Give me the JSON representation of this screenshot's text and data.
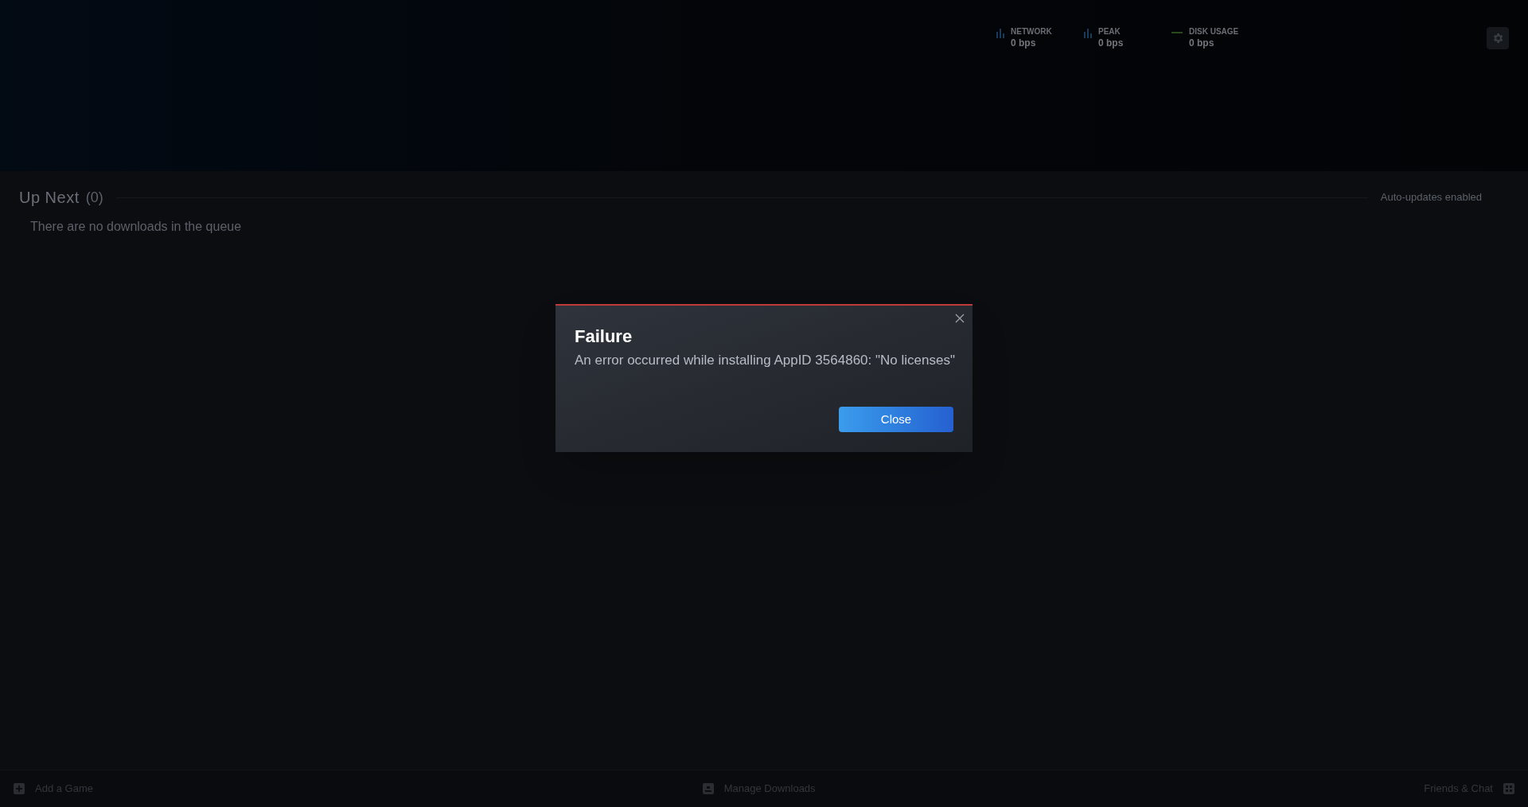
{
  "header": {
    "stats": [
      {
        "label": "NETWORK",
        "value": "0 bps",
        "kind": "bars",
        "color": "#1a3a5c"
      },
      {
        "label": "PEAK",
        "value": "0 bps",
        "kind": "bars",
        "color": "#1a3a5c"
      },
      {
        "label": "DISK USAGE",
        "value": "0 bps",
        "kind": "line",
        "color": "#2b4a1c"
      }
    ]
  },
  "queue": {
    "title": "Up Next",
    "count": "(0)",
    "auto_updates": "Auto-updates enabled",
    "empty_message": "There are no downloads in the queue"
  },
  "dialog": {
    "title": "Failure",
    "message": "An error occurred while installing AppID 3564860: \"No licenses\"",
    "button": "Close"
  },
  "footer": {
    "add_game": "Add a Game",
    "manage_downloads": "Manage Downloads",
    "friends_chat": "Friends & Chat"
  }
}
